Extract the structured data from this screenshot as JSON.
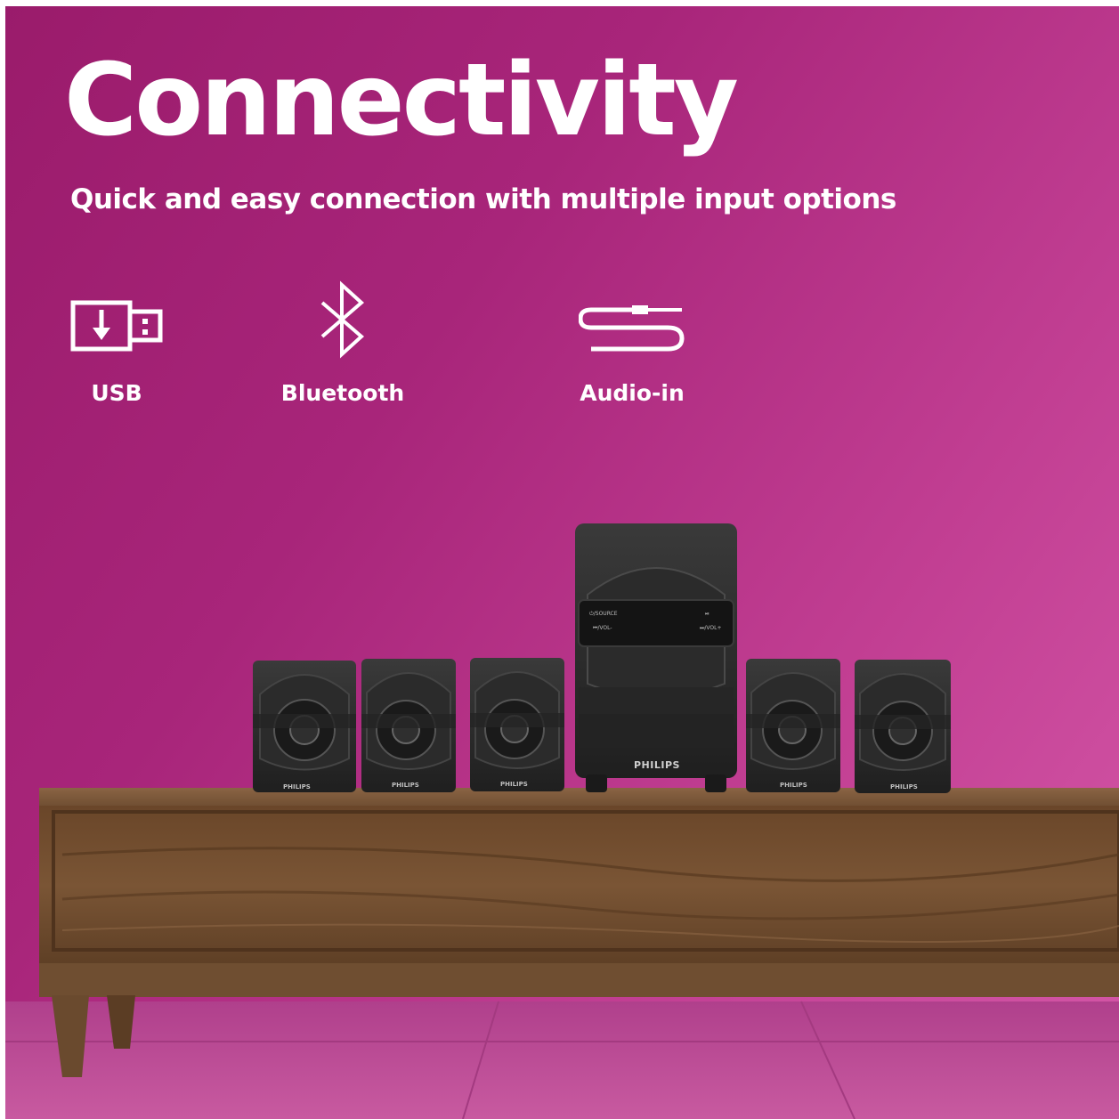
{
  "headline": "Connectivity",
  "subheadline": "Quick and easy connection with multiple input options",
  "features": [
    {
      "icon": "usb-drive-icon",
      "label": "USB"
    },
    {
      "icon": "bluetooth-icon",
      "label": "Bluetooth"
    },
    {
      "icon": "audio-cable-icon",
      "label": "Audio-in"
    }
  ],
  "product": {
    "brand_label": "PHILIPS",
    "subwoofer_panel": {
      "source_label": "⏻/SOURCE",
      "prev_label": "⏮/VOL-",
      "next_label": "⏭/VOL+",
      "play_label": "⏯"
    }
  },
  "colors": {
    "background_start": "#9a1b6b",
    "background_end": "#d558a8",
    "text": "#ffffff",
    "wood": "#6b4a2e",
    "speaker": "#2a2a2a"
  }
}
